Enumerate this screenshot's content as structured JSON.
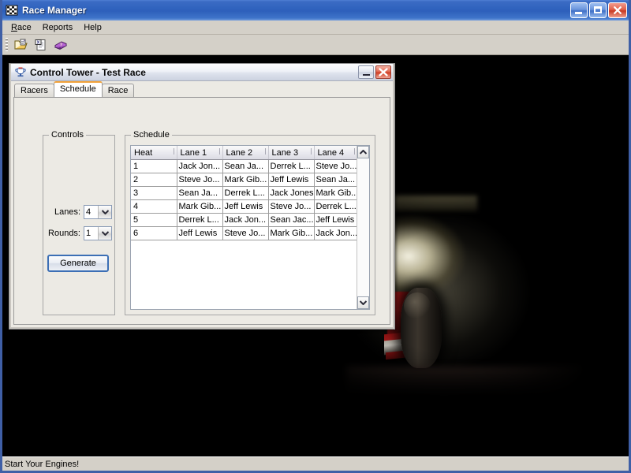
{
  "window": {
    "title": "Race Manager",
    "icon": "checkered-flag-icon",
    "minimize_label": "Minimize",
    "maximize_label": "Maximize",
    "close_label": "Close"
  },
  "menubar": {
    "items": [
      {
        "label": "Race",
        "mnemonic": "R"
      },
      {
        "label": "Reports",
        "mnemonic": ""
      },
      {
        "label": "Help",
        "mnemonic": ""
      }
    ]
  },
  "toolbar": {
    "buttons": [
      {
        "name": "open-file-icon",
        "tooltip": "Open"
      },
      {
        "name": "export-document-icon",
        "tooltip": "Export"
      },
      {
        "name": "help-book-icon",
        "tooltip": "Help"
      }
    ]
  },
  "statusbar": {
    "message": "Start Your Engines!"
  },
  "dialog": {
    "title": "Control Tower - Test Race",
    "icon": "trophy-icon",
    "minimize_label": "Minimize",
    "close_label": "Close",
    "tabs": [
      {
        "label": "Racers",
        "selected": false
      },
      {
        "label": "Schedule",
        "selected": true
      },
      {
        "label": "Race",
        "selected": false
      }
    ],
    "controls": {
      "title": "Controls",
      "lanes_label": "Lanes:",
      "lanes_value": "4",
      "rounds_label": "Rounds:",
      "rounds_value": "1",
      "generate_label": "Generate"
    },
    "schedule": {
      "title": "Schedule",
      "columns": [
        "Heat",
        "Lane 1",
        "Lane 2",
        "Lane 3",
        "Lane 4"
      ],
      "rows": [
        [
          "1",
          "Jack Jon...",
          "Sean Ja...",
          "Derrek L...",
          "Steve Jo..."
        ],
        [
          "2",
          "Steve Jo...",
          "Mark Gib...",
          "Jeff Lewis",
          "Sean Ja..."
        ],
        [
          "3",
          "Sean Ja...",
          "Derrek L...",
          "Jack Jones",
          "Mark Gib..."
        ],
        [
          "4",
          "Mark Gib...",
          "Jeff Lewis",
          "Steve Jo...",
          "Derrek L..."
        ],
        [
          "5",
          "Derrek L...",
          "Jack Jon...",
          "Sean Jac...",
          "Jeff Lewis"
        ],
        [
          "6",
          "Jeff Lewis",
          "Steve Jo...",
          "Mark Gib...",
          "Jack Jon..."
        ]
      ],
      "scroll_up_label": "Scroll up",
      "scroll_down_label": "Scroll down"
    }
  },
  "colors": {
    "titlebar_blue": "#3063be",
    "close_red": "#cf4026",
    "tab_accent_orange": "#f2a33c",
    "face_gray": "#d4d0c8",
    "dialog_face": "#eceae4",
    "focus_blue": "#3c6fb5"
  }
}
